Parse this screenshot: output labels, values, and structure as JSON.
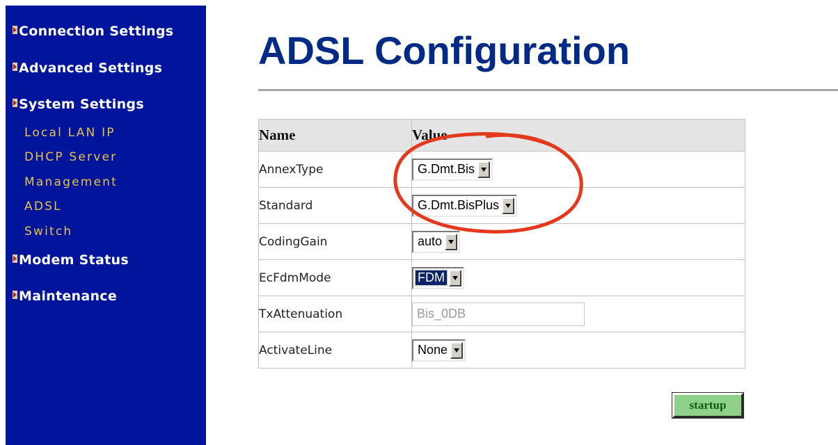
{
  "sidebar": {
    "sections": [
      {
        "label": "Connection Settings"
      },
      {
        "label": "Advanced Settings"
      },
      {
        "label": "System Settings"
      },
      {
        "label": "Modem Status"
      },
      {
        "label": "Maintenance"
      }
    ],
    "system_items": [
      {
        "label": "Local LAN IP"
      },
      {
        "label": "DHCP Server"
      },
      {
        "label": "Management"
      },
      {
        "label": "ADSL"
      },
      {
        "label": "Switch"
      }
    ]
  },
  "main": {
    "title": "ADSL Configuration",
    "table": {
      "headers": {
        "name": "Name",
        "value": "Value"
      },
      "rows": [
        {
          "name": "AnnexType",
          "value": "G.Dmt.Bis"
        },
        {
          "name": "Standard",
          "value": "G.Dmt.BisPlus"
        },
        {
          "name": "CodingGain",
          "value": "auto"
        },
        {
          "name": "EcFdmMode",
          "value": "FDM"
        },
        {
          "name": "TxAttenuation",
          "value": "Bis_0DB"
        },
        {
          "name": "ActivateLine",
          "value": "None"
        }
      ]
    },
    "startup_label": "startup"
  },
  "colors": {
    "sidebar_bg": "#00159b",
    "sidebar_subitem": "#e8c24a",
    "title": "#002a86",
    "startup_bg": "#8fd08a",
    "annotation_circle": "#e3391c"
  },
  "icons": {
    "section_marker": "arrow-right-icon",
    "select_toggle": "chevron-down-icon"
  }
}
